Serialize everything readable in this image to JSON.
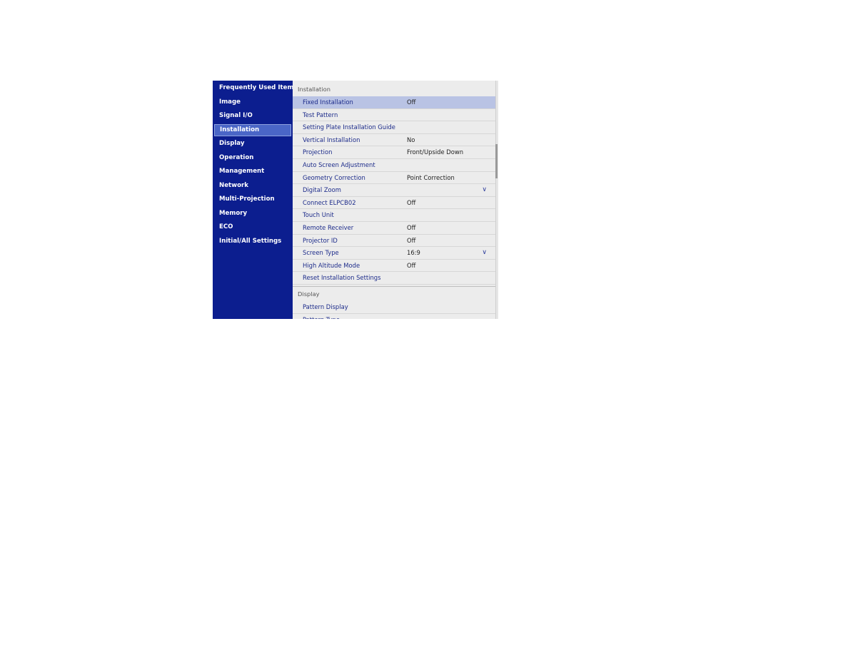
{
  "sidebar": {
    "items": [
      {
        "label": "Frequently Used Items",
        "active": false
      },
      {
        "label": "Image",
        "active": false
      },
      {
        "label": "Signal I/O",
        "active": false
      },
      {
        "label": "Installation",
        "active": true
      },
      {
        "label": "Display",
        "active": false
      },
      {
        "label": "Operation",
        "active": false
      },
      {
        "label": "Management",
        "active": false
      },
      {
        "label": "Network",
        "active": false
      },
      {
        "label": "Multi-Projection",
        "active": false
      },
      {
        "label": "Memory",
        "active": false
      },
      {
        "label": "ECO",
        "active": false
      },
      {
        "label": "Initial/All Settings",
        "active": false
      }
    ]
  },
  "content": {
    "sections": [
      {
        "title": "Installation",
        "rows": [
          {
            "label": "Fixed Installation",
            "value": "Off",
            "selected": true,
            "dropdown": false
          },
          {
            "label": "Test Pattern",
            "value": "",
            "selected": false,
            "dropdown": false
          },
          {
            "label": "Setting Plate Installation Guide",
            "value": "",
            "selected": false,
            "dropdown": false
          },
          {
            "label": "Vertical Installation",
            "value": "No",
            "selected": false,
            "dropdown": false
          },
          {
            "label": "Projection",
            "value": "Front/Upside Down",
            "selected": false,
            "dropdown": false
          },
          {
            "label": "Auto Screen Adjustment",
            "value": "",
            "selected": false,
            "dropdown": false
          },
          {
            "label": "Geometry Correction",
            "value": "Point Correction",
            "selected": false,
            "dropdown": false
          },
          {
            "label": "Digital Zoom",
            "value": "",
            "selected": false,
            "dropdown": true
          },
          {
            "label": "Connect ELPCB02",
            "value": "Off",
            "selected": false,
            "dropdown": false
          },
          {
            "label": "Touch Unit",
            "value": "",
            "selected": false,
            "dropdown": false
          },
          {
            "label": "Remote Receiver",
            "value": "Off",
            "selected": false,
            "dropdown": false
          },
          {
            "label": "Projector ID",
            "value": "Off",
            "selected": false,
            "dropdown": false
          },
          {
            "label": "Screen Type",
            "value": "16:9",
            "selected": false,
            "dropdown": true
          },
          {
            "label": "High Altitude Mode",
            "value": "Off",
            "selected": false,
            "dropdown": false
          },
          {
            "label": "Reset Installation Settings",
            "value": "",
            "selected": false,
            "dropdown": false
          }
        ]
      },
      {
        "title": "Display",
        "rows": [
          {
            "label": "Pattern Display",
            "value": "",
            "selected": false,
            "dropdown": false
          },
          {
            "label": "Pattern Type",
            "value": "",
            "selected": false,
            "dropdown": false
          }
        ]
      }
    ]
  },
  "icons": {
    "chevron": "∨"
  }
}
